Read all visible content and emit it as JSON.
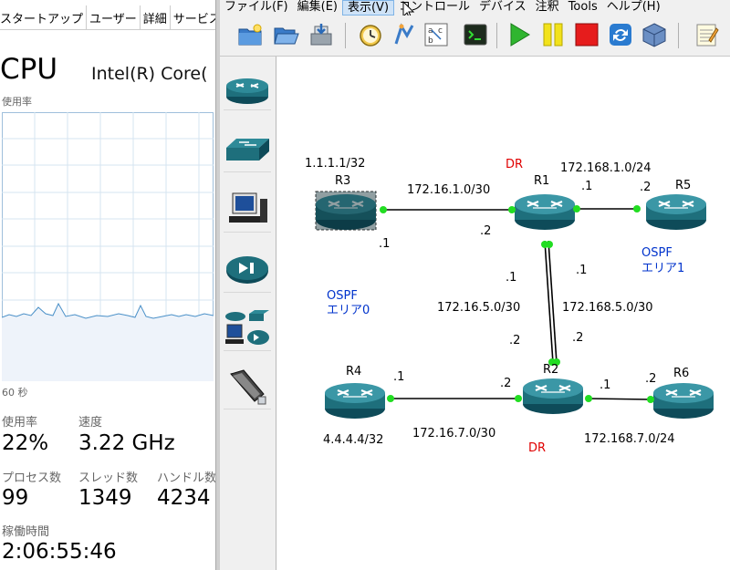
{
  "task_manager": {
    "tabs": [
      "スタートアップ",
      "ユーザー",
      "詳細",
      "サービス"
    ],
    "cpu_title": "CPU",
    "cpu_model": "Intel(R) Core(",
    "usage_graph_label": "使用率",
    "time_label": "60 秒",
    "utilization_label": "使用率",
    "utilization_value": "22%",
    "speed_label": "速度",
    "speed_value": "3.22 GHz",
    "processes_label": "プロセス数",
    "processes_value": "99",
    "threads_label": "スレッド数",
    "threads_value": "1349",
    "handles_label": "ハンドル数",
    "handles_value": "4234",
    "uptime_label": "稼働時間",
    "uptime_value": "2:06:55:46",
    "graph_colors": {
      "line": "#4a90c8",
      "fill": "#eef3fa",
      "grid": "#d6e4f0"
    }
  },
  "menubar": [
    "ファイル(F)",
    "編集(E)",
    "表示(V)",
    "コントロール",
    "デバイス",
    "注釈",
    "Tools",
    "ヘルプ(H)"
  ],
  "toolbar_icons": [
    "new-project-icon",
    "open-folder-icon",
    "save-icon",
    "snapshot-icon",
    "auto-arrange-icon",
    "show-interface-labels-icon",
    "console-icon",
    "start-icon",
    "pause-icon",
    "stop-icon",
    "reload-icon",
    "virtualbox-icon",
    "note-icon"
  ],
  "device_types": [
    "router-icon",
    "switch-icon",
    "end-device-icon",
    "security-device-icon",
    "all-devices-icon",
    "add-link-icon"
  ],
  "topology": {
    "routers": {
      "R1": {
        "name": "R1",
        "role": "DR"
      },
      "R2": {
        "name": "R2",
        "role": "DR"
      },
      "R3": {
        "name": "R3",
        "loopback": "1.1.1.1/32"
      },
      "R4": {
        "name": "R4",
        "loopback": "4.4.4.4/32"
      },
      "R5": {
        "name": "R5"
      },
      "R6": {
        "name": "R6"
      }
    },
    "networks": {
      "r3_r1": "172.16.1.0/30",
      "r1_r5": "172.168.1.0/24",
      "r1_r2_a": "172.16.5.0/30",
      "r1_r2_b": "172.168.5.0/30",
      "r4_r2": "172.16.7.0/30",
      "r2_r6": "172.168.7.0/24"
    },
    "hosts": {
      "h1": ".1",
      "h2": ".2"
    },
    "areas": {
      "area0_title": "OSPF",
      "area0_name": "エリア0",
      "area1_title": "OSPF",
      "area1_name": "エリア1"
    },
    "colors": {
      "router_body": "#1e6f7c",
      "link": "#000000",
      "port": "#22dd22",
      "dr_label": "#e00000",
      "area_label": "#0033cc"
    }
  }
}
